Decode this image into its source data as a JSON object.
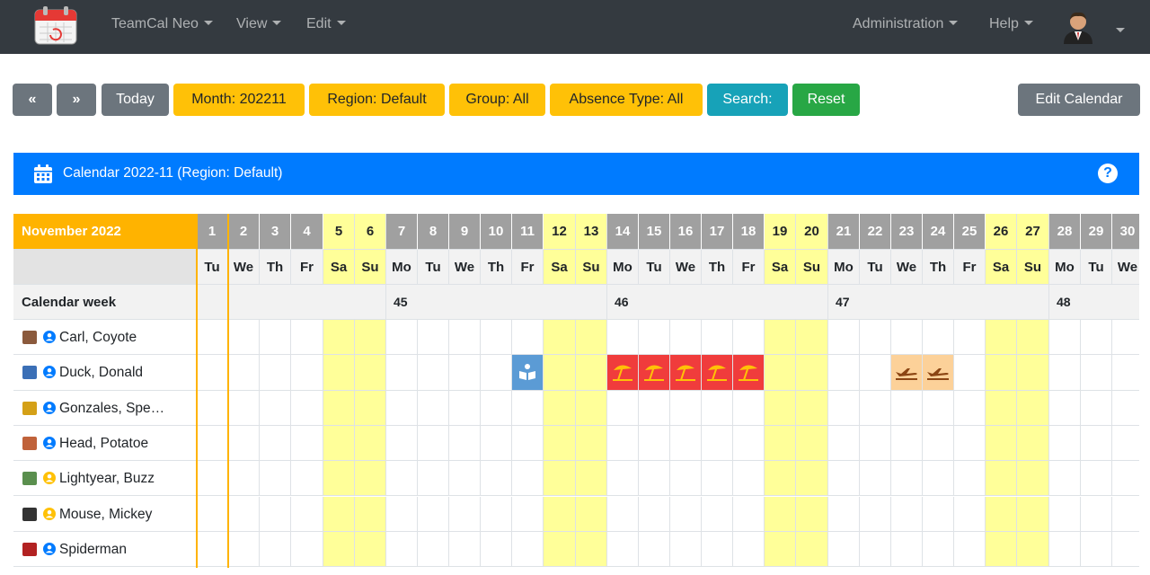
{
  "navbar": {
    "brand": "TeamCal Neo",
    "view": "View",
    "edit": "Edit",
    "administration": "Administration",
    "help": "Help",
    "logo_icon": "calendar-logo-icon",
    "avatar_icon": "user-avatar-icon"
  },
  "toolbar": {
    "prev": "«",
    "next": "»",
    "today": "Today",
    "month": "Month: 202211",
    "region": "Region: Default",
    "group": "Group: All",
    "absence_type": "Absence Type: All",
    "search": "Search:",
    "reset": "Reset",
    "edit_calendar": "Edit Calendar"
  },
  "banner": {
    "title": "Calendar 2022-11 (Region: Default)",
    "help": "?"
  },
  "calendar": {
    "month_label": "November 2022",
    "week_label": "Calendar week",
    "days": [
      {
        "num": "1",
        "name": "Tu",
        "weekend": false
      },
      {
        "num": "2",
        "name": "We",
        "weekend": false
      },
      {
        "num": "3",
        "name": "Th",
        "weekend": false
      },
      {
        "num": "4",
        "name": "Fr",
        "weekend": false
      },
      {
        "num": "5",
        "name": "Sa",
        "weekend": true
      },
      {
        "num": "6",
        "name": "Su",
        "weekend": true
      },
      {
        "num": "7",
        "name": "Mo",
        "weekend": false
      },
      {
        "num": "8",
        "name": "Tu",
        "weekend": false
      },
      {
        "num": "9",
        "name": "We",
        "weekend": false
      },
      {
        "num": "10",
        "name": "Th",
        "weekend": false
      },
      {
        "num": "11",
        "name": "Fr",
        "weekend": false
      },
      {
        "num": "12",
        "name": "Sa",
        "weekend": true
      },
      {
        "num": "13",
        "name": "Su",
        "weekend": true
      },
      {
        "num": "14",
        "name": "Mo",
        "weekend": false
      },
      {
        "num": "15",
        "name": "Tu",
        "weekend": false
      },
      {
        "num": "16",
        "name": "We",
        "weekend": false
      },
      {
        "num": "17",
        "name": "Th",
        "weekend": false
      },
      {
        "num": "18",
        "name": "Fr",
        "weekend": false
      },
      {
        "num": "19",
        "name": "Sa",
        "weekend": true
      },
      {
        "num": "20",
        "name": "Su",
        "weekend": true
      },
      {
        "num": "21",
        "name": "Mo",
        "weekend": false
      },
      {
        "num": "22",
        "name": "Tu",
        "weekend": false
      },
      {
        "num": "23",
        "name": "We",
        "weekend": false
      },
      {
        "num": "24",
        "name": "Th",
        "weekend": false
      },
      {
        "num": "25",
        "name": "Fr",
        "weekend": false
      },
      {
        "num": "26",
        "name": "Sa",
        "weekend": true
      },
      {
        "num": "27",
        "name": "Su",
        "weekend": true
      },
      {
        "num": "28",
        "name": "Mo",
        "weekend": false
      },
      {
        "num": "29",
        "name": "Tu",
        "weekend": false
      },
      {
        "num": "30",
        "name": "We",
        "weekend": false
      }
    ],
    "weeks": [
      {
        "label": "",
        "first_day": 1,
        "last_day": 6
      },
      {
        "label": "45",
        "first_day": 7,
        "last_day": 13
      },
      {
        "label": "46",
        "first_day": 14,
        "last_day": 20
      },
      {
        "label": "47",
        "first_day": 21,
        "last_day": 27
      },
      {
        "label": "48",
        "first_day": 28,
        "last_day": 30
      }
    ],
    "users": [
      {
        "name": "Carl, Coyote",
        "role_color": "#007bff",
        "avatar_color": "#8b5a3c"
      },
      {
        "name": "Duck, Donald",
        "role_color": "#007bff",
        "avatar_color": "#3b6fb6"
      },
      {
        "name": "Gonzales, Spe…",
        "role_color": "#007bff",
        "avatar_color": "#d4a017"
      },
      {
        "name": "Head, Potatoe",
        "role_color": "#007bff",
        "avatar_color": "#c0623a"
      },
      {
        "name": "Lightyear, Buzz",
        "role_color": "#ffc107",
        "avatar_color": "#5a8f4e"
      },
      {
        "name": "Mouse, Mickey",
        "role_color": "#ffc107",
        "avatar_color": "#333333"
      },
      {
        "name": "Spiderman",
        "role_color": "#007bff",
        "avatar_color": "#b22222"
      }
    ],
    "absences": [
      {
        "user": 1,
        "day": 11,
        "type": "training",
        "icon": "book-reader-icon",
        "color": "#5b9bd5"
      },
      {
        "user": 1,
        "day": 14,
        "type": "vacation",
        "icon": "umbrella-beach-icon",
        "color": "#f03c3c"
      },
      {
        "user": 1,
        "day": 15,
        "type": "vacation",
        "icon": "umbrella-beach-icon",
        "color": "#f03c3c"
      },
      {
        "user": 1,
        "day": 16,
        "type": "vacation",
        "icon": "umbrella-beach-icon",
        "color": "#f03c3c"
      },
      {
        "user": 1,
        "day": 17,
        "type": "vacation",
        "icon": "umbrella-beach-icon",
        "color": "#f03c3c"
      },
      {
        "user": 1,
        "day": 18,
        "type": "vacation",
        "icon": "umbrella-beach-icon",
        "color": "#f03c3c"
      },
      {
        "user": 1,
        "day": 23,
        "type": "business-trip",
        "icon": "plane-icon",
        "color": "#fcd199"
      },
      {
        "user": 1,
        "day": 24,
        "type": "business-trip",
        "icon": "plane-icon",
        "color": "#fcd199"
      }
    ],
    "today_day": 1,
    "colors": {
      "month_header": "#ffb300",
      "weekend": "#ffff99",
      "weekday_header": "#a0a0a0",
      "today_line": "#ffb300"
    }
  }
}
